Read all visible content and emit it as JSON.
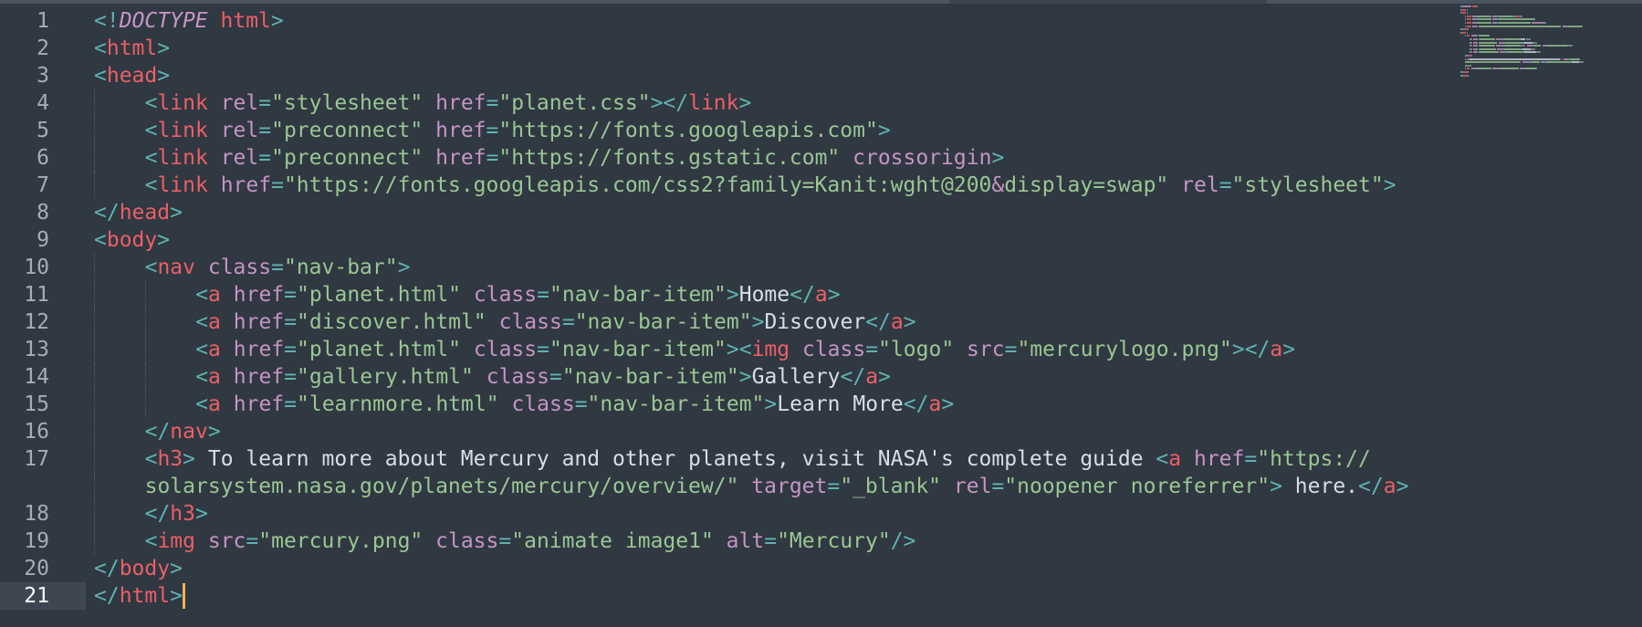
{
  "editor": {
    "current_line": 21,
    "lines": [
      {
        "n": "1",
        "indent": 0,
        "tokens": [
          [
            "punct",
            "<!"
          ],
          [
            "doctype",
            "DOCTYPE"
          ],
          [
            "text",
            " "
          ],
          [
            "tag",
            "html"
          ],
          [
            "punct",
            ">"
          ]
        ]
      },
      {
        "n": "2",
        "indent": 0,
        "tokens": [
          [
            "punct",
            "<"
          ],
          [
            "tag",
            "html"
          ],
          [
            "punct",
            ">"
          ]
        ]
      },
      {
        "n": "3",
        "indent": 0,
        "tokens": [
          [
            "punct",
            "<"
          ],
          [
            "tag",
            "head"
          ],
          [
            "punct",
            ">"
          ]
        ]
      },
      {
        "n": "4",
        "indent": 1,
        "tokens": [
          [
            "punct",
            "<"
          ],
          [
            "tag",
            "link"
          ],
          [
            "text",
            " "
          ],
          [
            "attr",
            "rel"
          ],
          [
            "punct",
            "="
          ],
          [
            "str",
            "\"stylesheet\""
          ],
          [
            "text",
            " "
          ],
          [
            "attr",
            "href"
          ],
          [
            "punct",
            "="
          ],
          [
            "str",
            "\"planet.css\""
          ],
          [
            "punct",
            "></"
          ],
          [
            "tag",
            "link"
          ],
          [
            "punct",
            ">"
          ]
        ]
      },
      {
        "n": "5",
        "indent": 1,
        "tokens": [
          [
            "punct",
            "<"
          ],
          [
            "tag",
            "link"
          ],
          [
            "text",
            " "
          ],
          [
            "attr",
            "rel"
          ],
          [
            "punct",
            "="
          ],
          [
            "str",
            "\"preconnect\""
          ],
          [
            "text",
            " "
          ],
          [
            "attr",
            "href"
          ],
          [
            "punct",
            "="
          ],
          [
            "str",
            "\"https://fonts.googleapis.com\""
          ],
          [
            "punct",
            ">"
          ]
        ]
      },
      {
        "n": "6",
        "indent": 1,
        "tokens": [
          [
            "punct",
            "<"
          ],
          [
            "tag",
            "link"
          ],
          [
            "text",
            " "
          ],
          [
            "attr",
            "rel"
          ],
          [
            "punct",
            "="
          ],
          [
            "str",
            "\"preconnect\""
          ],
          [
            "text",
            " "
          ],
          [
            "attr",
            "href"
          ],
          [
            "punct",
            "="
          ],
          [
            "str",
            "\"https://fonts.gstatic.com\""
          ],
          [
            "text",
            " "
          ],
          [
            "attr",
            "crossorigin"
          ],
          [
            "punct",
            ">"
          ]
        ]
      },
      {
        "n": "7",
        "indent": 1,
        "tokens": [
          [
            "punct",
            "<"
          ],
          [
            "tag",
            "link"
          ],
          [
            "text",
            " "
          ],
          [
            "attr",
            "href"
          ],
          [
            "punct",
            "="
          ],
          [
            "str",
            "\"https://fonts.googleapis.com/css2?family=Kanit:wght@200"
          ],
          [
            "ent",
            "&"
          ],
          [
            "str",
            "display=swap\""
          ],
          [
            "text",
            " "
          ],
          [
            "attr",
            "rel"
          ],
          [
            "punct",
            "="
          ],
          [
            "str",
            "\"stylesheet\""
          ],
          [
            "punct",
            ">"
          ]
        ]
      },
      {
        "n": "8",
        "indent": 0,
        "tokens": [
          [
            "punct",
            "</"
          ],
          [
            "tag",
            "head"
          ],
          [
            "punct",
            ">"
          ]
        ]
      },
      {
        "n": "9",
        "indent": 0,
        "tokens": [
          [
            "punct",
            "<"
          ],
          [
            "tag",
            "body"
          ],
          [
            "punct",
            ">"
          ]
        ]
      },
      {
        "n": "10",
        "indent": 1,
        "tokens": [
          [
            "punct",
            "<"
          ],
          [
            "tag",
            "nav"
          ],
          [
            "text",
            " "
          ],
          [
            "attr",
            "class"
          ],
          [
            "punct",
            "="
          ],
          [
            "str",
            "\"nav-bar\""
          ],
          [
            "punct",
            ">"
          ]
        ]
      },
      {
        "n": "11",
        "indent": 2,
        "tokens": [
          [
            "punct",
            "<"
          ],
          [
            "tag",
            "a"
          ],
          [
            "text",
            " "
          ],
          [
            "attr",
            "href"
          ],
          [
            "punct",
            "="
          ],
          [
            "str",
            "\"planet.html\""
          ],
          [
            "text",
            " "
          ],
          [
            "attr",
            "class"
          ],
          [
            "punct",
            "="
          ],
          [
            "str",
            "\"nav-bar-item\""
          ],
          [
            "punct",
            ">"
          ],
          [
            "text",
            "Home"
          ],
          [
            "punct",
            "</"
          ],
          [
            "tag",
            "a"
          ],
          [
            "punct",
            ">"
          ]
        ]
      },
      {
        "n": "12",
        "indent": 2,
        "tokens": [
          [
            "punct",
            "<"
          ],
          [
            "tag",
            "a"
          ],
          [
            "text",
            " "
          ],
          [
            "attr",
            "href"
          ],
          [
            "punct",
            "="
          ],
          [
            "str",
            "\"discover.html\""
          ],
          [
            "text",
            " "
          ],
          [
            "attr",
            "class"
          ],
          [
            "punct",
            "="
          ],
          [
            "str",
            "\"nav-bar-item\""
          ],
          [
            "punct",
            ">"
          ],
          [
            "text",
            "Discover"
          ],
          [
            "punct",
            "</"
          ],
          [
            "tag",
            "a"
          ],
          [
            "punct",
            ">"
          ]
        ]
      },
      {
        "n": "13",
        "indent": 2,
        "tokens": [
          [
            "punct",
            "<"
          ],
          [
            "tag",
            "a"
          ],
          [
            "text",
            " "
          ],
          [
            "attr",
            "href"
          ],
          [
            "punct",
            "="
          ],
          [
            "str",
            "\"planet.html\""
          ],
          [
            "text",
            " "
          ],
          [
            "attr",
            "class"
          ],
          [
            "punct",
            "="
          ],
          [
            "str",
            "\"nav-bar-item\""
          ],
          [
            "punct",
            "><"
          ],
          [
            "tag",
            "img"
          ],
          [
            "text",
            " "
          ],
          [
            "attr",
            "class"
          ],
          [
            "punct",
            "="
          ],
          [
            "str",
            "\"logo\""
          ],
          [
            "text",
            " "
          ],
          [
            "attr",
            "src"
          ],
          [
            "punct",
            "="
          ],
          [
            "str",
            "\"mercurylogo.png\""
          ],
          [
            "punct",
            "></"
          ],
          [
            "tag",
            "a"
          ],
          [
            "punct",
            ">"
          ]
        ]
      },
      {
        "n": "14",
        "indent": 2,
        "tokens": [
          [
            "punct",
            "<"
          ],
          [
            "tag",
            "a"
          ],
          [
            "text",
            " "
          ],
          [
            "attr",
            "href"
          ],
          [
            "punct",
            "="
          ],
          [
            "str",
            "\"gallery.html\""
          ],
          [
            "text",
            " "
          ],
          [
            "attr",
            "class"
          ],
          [
            "punct",
            "="
          ],
          [
            "str",
            "\"nav-bar-item\""
          ],
          [
            "punct",
            ">"
          ],
          [
            "text",
            "Gallery"
          ],
          [
            "punct",
            "</"
          ],
          [
            "tag",
            "a"
          ],
          [
            "punct",
            ">"
          ]
        ]
      },
      {
        "n": "15",
        "indent": 2,
        "tokens": [
          [
            "punct",
            "<"
          ],
          [
            "tag",
            "a"
          ],
          [
            "text",
            " "
          ],
          [
            "attr",
            "href"
          ],
          [
            "punct",
            "="
          ],
          [
            "str",
            "\"learnmore.html\""
          ],
          [
            "text",
            " "
          ],
          [
            "attr",
            "class"
          ],
          [
            "punct",
            "="
          ],
          [
            "str",
            "\"nav-bar-item\""
          ],
          [
            "punct",
            ">"
          ],
          [
            "text",
            "Learn More"
          ],
          [
            "punct",
            "</"
          ],
          [
            "tag",
            "a"
          ],
          [
            "punct",
            ">"
          ]
        ]
      },
      {
        "n": "16",
        "indent": 1,
        "tokens": [
          [
            "punct",
            "</"
          ],
          [
            "tag",
            "nav"
          ],
          [
            "punct",
            ">"
          ]
        ]
      },
      {
        "n": "17",
        "indent": 1,
        "tokens": [
          [
            "punct",
            "<"
          ],
          [
            "tag",
            "h3"
          ],
          [
            "punct",
            ">"
          ],
          [
            "text",
            " To learn more about Mercury and other planets, visit NASA's complete guide "
          ],
          [
            "punct",
            "<"
          ],
          [
            "tag",
            "a"
          ],
          [
            "text",
            " "
          ],
          [
            "attr",
            "href"
          ],
          [
            "punct",
            "="
          ],
          [
            "str",
            "\"https://"
          ]
        ]
      },
      {
        "n": "",
        "indent": 1,
        "tokens": [
          [
            "str",
            "solarsystem.nasa.gov/planets/mercury/overview/\""
          ],
          [
            "text",
            " "
          ],
          [
            "attr",
            "target"
          ],
          [
            "punct",
            "="
          ],
          [
            "str",
            "\"_blank\""
          ],
          [
            "text",
            " "
          ],
          [
            "attr",
            "rel"
          ],
          [
            "punct",
            "="
          ],
          [
            "str",
            "\"noopener noreferrer\""
          ],
          [
            "punct",
            ">"
          ],
          [
            "text",
            " here."
          ],
          [
            "punct",
            "</"
          ],
          [
            "tag",
            "a"
          ],
          [
            "punct",
            ">"
          ]
        ]
      },
      {
        "n": "18",
        "indent": 1,
        "tokens": [
          [
            "punct",
            "</"
          ],
          [
            "tag",
            "h3"
          ],
          [
            "punct",
            ">"
          ]
        ]
      },
      {
        "n": "19",
        "indent": 1,
        "tokens": [
          [
            "punct",
            "<"
          ],
          [
            "tag",
            "img"
          ],
          [
            "text",
            " "
          ],
          [
            "attr",
            "src"
          ],
          [
            "punct",
            "="
          ],
          [
            "str",
            "\"mercury.png\""
          ],
          [
            "text",
            " "
          ],
          [
            "attr",
            "class"
          ],
          [
            "punct",
            "="
          ],
          [
            "str",
            "\"animate image1\""
          ],
          [
            "text",
            " "
          ],
          [
            "attr",
            "alt"
          ],
          [
            "punct",
            "="
          ],
          [
            "str",
            "\"Mercury\""
          ],
          [
            "punct",
            "/>"
          ]
        ]
      },
      {
        "n": "20",
        "indent": 0,
        "tokens": [
          [
            "punct",
            "</"
          ],
          [
            "tag",
            "body"
          ],
          [
            "punct",
            ">"
          ]
        ]
      },
      {
        "n": "21",
        "indent": 0,
        "tokens": [
          [
            "punct",
            "</"
          ],
          [
            "tag",
            "html"
          ],
          [
            "punct",
            ">"
          ]
        ]
      }
    ]
  },
  "colors": {
    "background": "#303841",
    "tag": "#ec5f67",
    "punct": "#5fb3b3",
    "attr": "#c594c5",
    "string": "#99c794",
    "text": "#d8dee9",
    "line_number": "#a6acb9",
    "cursor": "#f9ae58"
  }
}
